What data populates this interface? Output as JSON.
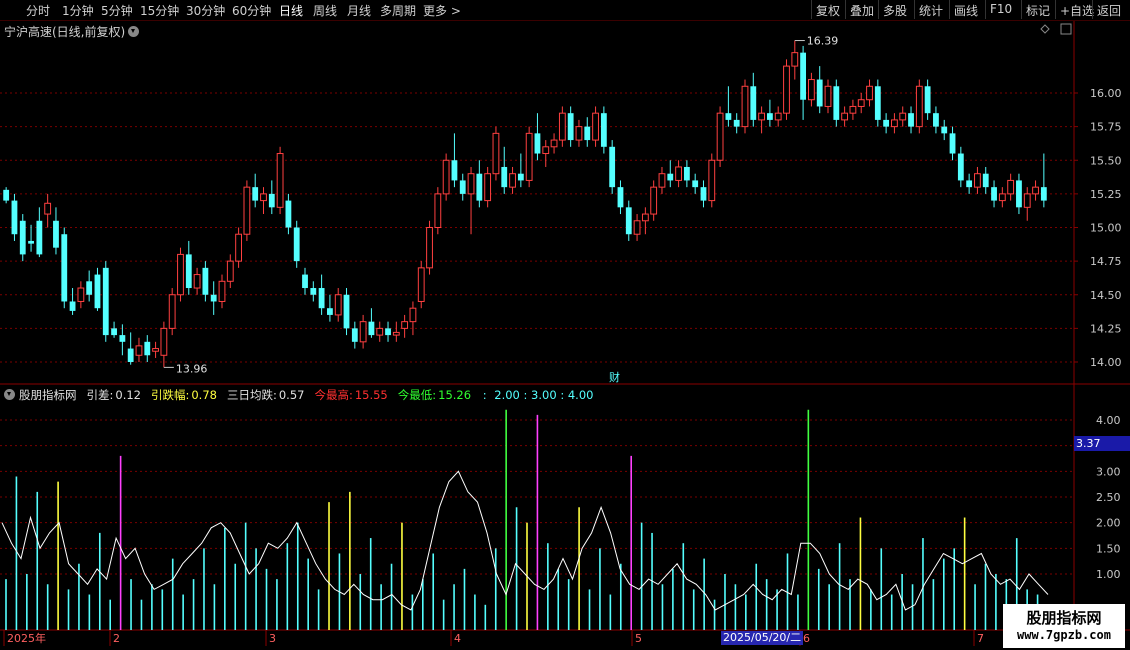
{
  "toolbar": {
    "periods": [
      "分时",
      "1分钟",
      "5分钟",
      "15分钟",
      "30分钟",
      "60分钟",
      "日线",
      "周线",
      "月线",
      "多周期",
      "更多 >"
    ],
    "active_period": "日线",
    "right_buttons": [
      "复权",
      "叠加",
      "多股",
      "统计",
      "画线",
      "F10",
      "标记",
      "+自选",
      "返回"
    ]
  },
  "stock": {
    "title": "宁沪高速(日线,前复权)",
    "max_label": "16.39",
    "min_label": "13.96",
    "finance_marker": "财"
  },
  "indicator": {
    "name": "股朋指标网",
    "fields": [
      {
        "label": "引差:",
        "value": "0.12",
        "label_color": "#e0e0e0",
        "value_color": "#e0e0e0"
      },
      {
        "label": "引跌幅:",
        "value": "0.78",
        "label_color": "#ffff40",
        "value_color": "#ffff40"
      },
      {
        "label": "三日均跌:",
        "value": "0.57",
        "label_color": "#e0e0e0",
        "value_color": "#e0e0e0"
      },
      {
        "label": "今最高:",
        "value": "15.55",
        "label_color": "#ff3030",
        "value_color": "#ff3030"
      },
      {
        "label": "今最低:",
        "value": "15.26",
        "label_color": "#30ff30",
        "value_color": "#30ff30"
      }
    ],
    "extra": "2.00 : 3.00 : 4.00",
    "extra_pre": " : ",
    "current_value": "3.37"
  },
  "price_axis": [
    "16.00",
    "15.75",
    "15.50",
    "15.25",
    "15.00",
    "14.75",
    "14.50",
    "14.25",
    "14.00"
  ],
  "indicator_axis": [
    "4.00",
    "3.50",
    "3.00",
    "2.50",
    "2.00",
    "1.50",
    "1.00"
  ],
  "time_axis": [
    "2025年",
    "2",
    "3",
    "4",
    "5",
    "6",
    "7"
  ],
  "cursor_date": "2025/05/20/二",
  "watermark": {
    "line1": "股朋指标网",
    "line2": "www.7gpzb.com"
  },
  "colors": {
    "up": "#ff4040",
    "down": "#54ffff",
    "grid": "#7a0000",
    "white_line": "#ffffff",
    "cyan_bar": "#54ffff",
    "yellow_bar": "#ffff40",
    "green_bar": "#40ff40",
    "magenta_bar": "#ff40ff"
  },
  "chart_data": {
    "type": "candlestick",
    "y_range": [
      13.9,
      16.5
    ],
    "candles": [
      [
        15.28,
        15.3,
        15.2,
        15.18
      ],
      [
        15.2,
        15.25,
        14.95,
        14.9
      ],
      [
        15.05,
        15.1,
        14.8,
        14.75
      ],
      [
        14.9,
        15.02,
        14.88,
        14.82
      ],
      [
        15.05,
        15.15,
        14.8,
        14.78
      ],
      [
        15.1,
        15.25,
        15.18,
        15.0
      ],
      [
        15.05,
        15.15,
        14.85,
        14.8
      ],
      [
        14.95,
        15.0,
        14.45,
        14.4
      ],
      [
        14.45,
        14.55,
        14.38,
        14.35
      ],
      [
        14.45,
        14.6,
        14.55,
        14.4
      ],
      [
        14.6,
        14.68,
        14.5,
        14.45
      ],
      [
        14.65,
        14.7,
        14.4,
        14.38
      ],
      [
        14.7,
        14.75,
        14.2,
        14.15
      ],
      [
        14.25,
        14.3,
        14.2,
        14.18
      ],
      [
        14.2,
        14.28,
        14.15,
        14.05
      ],
      [
        14.1,
        14.22,
        14.0,
        13.98
      ],
      [
        14.05,
        14.18,
        14.12,
        14.0
      ],
      [
        14.15,
        14.2,
        14.05,
        14.0
      ],
      [
        14.08,
        14.15,
        14.1,
        14.03
      ],
      [
        14.05,
        14.3,
        14.25,
        13.96
      ],
      [
        14.25,
        14.55,
        14.5,
        14.2
      ],
      [
        14.5,
        14.85,
        14.8,
        14.45
      ],
      [
        14.8,
        14.9,
        14.55,
        14.5
      ],
      [
        14.55,
        14.7,
        14.65,
        14.5
      ],
      [
        14.7,
        14.75,
        14.5,
        14.45
      ],
      [
        14.5,
        14.6,
        14.45,
        14.35
      ],
      [
        14.45,
        14.65,
        14.6,
        14.4
      ],
      [
        14.6,
        14.8,
        14.75,
        14.55
      ],
      [
        14.75,
        15.0,
        14.95,
        14.7
      ],
      [
        14.95,
        15.35,
        15.3,
        14.9
      ],
      [
        15.3,
        15.4,
        15.2,
        15.15
      ],
      [
        15.2,
        15.3,
        15.25,
        15.1
      ],
      [
        15.25,
        15.35,
        15.15,
        15.1
      ],
      [
        15.15,
        15.6,
        15.55,
        15.1
      ],
      [
        15.2,
        15.25,
        15.0,
        14.95
      ],
      [
        15.0,
        15.05,
        14.75,
        14.7
      ],
      [
        14.65,
        14.7,
        14.55,
        14.5
      ],
      [
        14.55,
        14.6,
        14.5,
        14.45
      ],
      [
        14.55,
        14.65,
        14.4,
        14.35
      ],
      [
        14.4,
        14.5,
        14.35,
        14.3
      ],
      [
        14.35,
        14.55,
        14.5,
        14.3
      ],
      [
        14.5,
        14.55,
        14.25,
        14.2
      ],
      [
        14.25,
        14.3,
        14.15,
        14.1
      ],
      [
        14.15,
        14.35,
        14.3,
        14.1
      ],
      [
        14.3,
        14.4,
        14.2,
        14.18
      ],
      [
        14.2,
        14.3,
        14.25,
        14.15
      ],
      [
        14.25,
        14.3,
        14.2,
        14.15
      ],
      [
        14.2,
        14.3,
        14.22,
        14.15
      ],
      [
        14.25,
        14.35,
        14.3,
        14.18
      ],
      [
        14.3,
        14.45,
        14.4,
        14.2
      ],
      [
        14.45,
        14.75,
        14.7,
        14.4
      ],
      [
        14.7,
        15.05,
        15.0,
        14.65
      ],
      [
        15.0,
        15.3,
        15.25,
        14.95
      ],
      [
        15.25,
        15.55,
        15.5,
        15.2
      ],
      [
        15.5,
        15.7,
        15.35,
        15.3
      ],
      [
        15.35,
        15.4,
        15.25,
        15.2
      ],
      [
        15.25,
        15.45,
        15.4,
        14.95
      ],
      [
        15.4,
        15.5,
        15.2,
        15.15
      ],
      [
        15.2,
        15.45,
        15.4,
        15.15
      ],
      [
        15.4,
        15.75,
        15.7,
        15.35
      ],
      [
        15.45,
        15.6,
        15.3,
        15.25
      ],
      [
        15.3,
        15.45,
        15.4,
        15.25
      ],
      [
        15.4,
        15.55,
        15.35,
        15.3
      ],
      [
        15.35,
        15.75,
        15.7,
        15.3
      ],
      [
        15.7,
        15.85,
        15.55,
        15.5
      ],
      [
        15.55,
        15.65,
        15.6,
        15.45
      ],
      [
        15.6,
        15.7,
        15.65,
        15.55
      ],
      [
        15.65,
        15.9,
        15.85,
        15.6
      ],
      [
        15.85,
        15.9,
        15.65,
        15.6
      ],
      [
        15.65,
        15.8,
        15.75,
        15.6
      ],
      [
        15.75,
        15.82,
        15.65,
        15.6
      ],
      [
        15.65,
        15.9,
        15.85,
        15.6
      ],
      [
        15.85,
        15.9,
        15.6,
        15.55
      ],
      [
        15.6,
        15.65,
        15.3,
        15.25
      ],
      [
        15.3,
        15.35,
        15.15,
        15.1
      ],
      [
        15.15,
        15.2,
        14.95,
        14.9
      ],
      [
        14.95,
        15.1,
        15.05,
        14.9
      ],
      [
        15.05,
        15.15,
        15.1,
        14.95
      ],
      [
        15.1,
        15.35,
        15.3,
        15.05
      ],
      [
        15.3,
        15.45,
        15.4,
        15.25
      ],
      [
        15.4,
        15.5,
        15.35,
        15.3
      ],
      [
        15.35,
        15.5,
        15.45,
        15.3
      ],
      [
        15.45,
        15.5,
        15.35,
        15.3
      ],
      [
        15.35,
        15.4,
        15.3,
        15.25
      ],
      [
        15.3,
        15.35,
        15.2,
        15.15
      ],
      [
        15.2,
        15.55,
        15.5,
        15.15
      ],
      [
        15.5,
        15.9,
        15.85,
        15.45
      ],
      [
        15.85,
        16.05,
        15.8,
        15.75
      ],
      [
        15.8,
        15.85,
        15.75,
        15.7
      ],
      [
        15.75,
        16.1,
        16.05,
        15.7
      ],
      [
        16.05,
        16.15,
        15.8,
        15.75
      ],
      [
        15.8,
        15.9,
        15.85,
        15.7
      ],
      [
        15.85,
        15.95,
        15.8,
        15.75
      ],
      [
        15.8,
        15.9,
        15.85,
        15.75
      ],
      [
        15.85,
        16.25,
        16.2,
        15.8
      ],
      [
        16.2,
        16.39,
        16.3,
        16.1
      ],
      [
        16.3,
        16.35,
        15.95,
        15.8
      ],
      [
        15.95,
        16.15,
        16.1,
        15.9
      ],
      [
        16.1,
        16.2,
        15.9,
        15.85
      ],
      [
        15.9,
        16.1,
        16.05,
        15.85
      ],
      [
        16.05,
        16.1,
        15.8,
        15.75
      ],
      [
        15.8,
        15.9,
        15.85,
        15.75
      ],
      [
        15.85,
        15.95,
        15.9,
        15.8
      ],
      [
        15.9,
        16.0,
        15.95,
        15.85
      ],
      [
        15.95,
        16.1,
        16.05,
        15.9
      ],
      [
        16.05,
        16.1,
        15.8,
        15.75
      ],
      [
        15.8,
        15.85,
        15.75,
        15.7
      ],
      [
        15.75,
        15.85,
        15.8,
        15.7
      ],
      [
        15.8,
        15.9,
        15.85,
        15.75
      ],
      [
        15.85,
        15.9,
        15.75,
        15.7
      ],
      [
        15.75,
        16.1,
        16.05,
        15.7
      ],
      [
        16.05,
        16.1,
        15.85,
        15.8
      ],
      [
        15.85,
        15.9,
        15.75,
        15.7
      ],
      [
        15.75,
        15.8,
        15.7,
        15.65
      ],
      [
        15.7,
        15.75,
        15.55,
        15.5
      ],
      [
        15.55,
        15.6,
        15.35,
        15.3
      ],
      [
        15.35,
        15.4,
        15.3,
        15.25
      ],
      [
        15.3,
        15.45,
        15.4,
        15.25
      ],
      [
        15.4,
        15.45,
        15.3,
        15.25
      ],
      [
        15.3,
        15.35,
        15.2,
        15.15
      ],
      [
        15.2,
        15.3,
        15.25,
        15.15
      ],
      [
        15.25,
        15.4,
        15.35,
        15.2
      ],
      [
        15.35,
        15.4,
        15.15,
        15.1
      ],
      [
        15.15,
        15.3,
        15.25,
        15.05
      ],
      [
        15.25,
        15.35,
        15.3,
        15.2
      ],
      [
        15.3,
        15.55,
        15.2,
        15.15
      ]
    ],
    "indicator_line": [
      2.0,
      1.6,
      1.3,
      2.1,
      1.5,
      1.8,
      2.0,
      1.2,
      1.0,
      0.8,
      1.1,
      0.9,
      1.7,
      1.3,
      1.5,
      1.0,
      0.7,
      0.8,
      0.9,
      1.2,
      1.4,
      1.6,
      1.9,
      2.0,
      1.8,
      1.4,
      1.0,
      1.2,
      1.6,
      1.5,
      1.7,
      2.0,
      1.6,
      1.2,
      0.9,
      0.7,
      0.6,
      0.8,
      0.6,
      0.5,
      0.5,
      0.6,
      0.4,
      0.3,
      0.7,
      1.5,
      2.3,
      2.8,
      3.0,
      2.6,
      2.4,
      1.8,
      1.0,
      0.6,
      1.2,
      1.0,
      0.8,
      0.7,
      0.9,
      1.3,
      0.9,
      1.5,
      1.8,
      2.3,
      1.8,
      1.1,
      0.8,
      0.7,
      0.9,
      0.8,
      1.0,
      1.2,
      0.9,
      0.8,
      0.6,
      0.3,
      0.4,
      0.5,
      0.6,
      0.8,
      0.6,
      0.5,
      0.7,
      0.6,
      1.6,
      1.6,
      1.4,
      1.0,
      0.8,
      0.7,
      0.9,
      0.8,
      0.5,
      0.6,
      0.8,
      0.3,
      0.4,
      0.8,
      1.1,
      1.4,
      1.3,
      1.2,
      1.3,
      1.4,
      1.0,
      0.8,
      0.9,
      0.7,
      1.0,
      0.8,
      0.6
    ],
    "indicator_bars": [
      [
        0.9,
        "c"
      ],
      [
        2.9,
        "c"
      ],
      [
        1.0,
        "c"
      ],
      [
        2.6,
        "c"
      ],
      [
        0.8,
        "c"
      ],
      [
        2.8,
        "y"
      ],
      [
        0.7,
        "c"
      ],
      [
        1.2,
        "c"
      ],
      [
        0.6,
        "c"
      ],
      [
        1.8,
        "c"
      ],
      [
        0.5,
        "c"
      ],
      [
        3.3,
        "m"
      ],
      [
        0.9,
        "c"
      ],
      [
        0.5,
        "c"
      ],
      [
        0.8,
        "c"
      ],
      [
        0.7,
        "c"
      ],
      [
        1.3,
        "c"
      ],
      [
        0.6,
        "c"
      ],
      [
        0.9,
        "c"
      ],
      [
        1.5,
        "c"
      ],
      [
        0.8,
        "c"
      ],
      [
        1.9,
        "c"
      ],
      [
        1.2,
        "c"
      ],
      [
        2.0,
        "c"
      ],
      [
        1.5,
        "c"
      ],
      [
        1.1,
        "c"
      ],
      [
        0.9,
        "c"
      ],
      [
        1.6,
        "c"
      ],
      [
        2.0,
        "c"
      ],
      [
        1.3,
        "c"
      ],
      [
        0.7,
        "c"
      ],
      [
        2.4,
        "y"
      ],
      [
        1.4,
        "c"
      ],
      [
        2.6,
        "y"
      ],
      [
        1.0,
        "c"
      ],
      [
        1.7,
        "c"
      ],
      [
        0.8,
        "c"
      ],
      [
        1.2,
        "c"
      ],
      [
        2.0,
        "y"
      ],
      [
        0.6,
        "c"
      ],
      [
        0.9,
        "c"
      ],
      [
        1.4,
        "c"
      ],
      [
        0.5,
        "c"
      ],
      [
        0.8,
        "c"
      ],
      [
        1.1,
        "c"
      ],
      [
        0.6,
        "c"
      ],
      [
        0.4,
        "c"
      ],
      [
        1.5,
        "c"
      ],
      [
        4.2,
        "g"
      ],
      [
        2.3,
        "c"
      ],
      [
        2.0,
        "y"
      ],
      [
        4.1,
        "m"
      ],
      [
        1.6,
        "c"
      ],
      [
        1.1,
        "c"
      ],
      [
        0.9,
        "c"
      ],
      [
        2.3,
        "y"
      ],
      [
        0.7,
        "c"
      ],
      [
        1.5,
        "c"
      ],
      [
        0.6,
        "c"
      ],
      [
        1.2,
        "c"
      ],
      [
        3.3,
        "m"
      ],
      [
        2.0,
        "c"
      ],
      [
        1.8,
        "c"
      ],
      [
        0.8,
        "c"
      ],
      [
        1.1,
        "c"
      ],
      [
        1.6,
        "c"
      ],
      [
        0.7,
        "c"
      ],
      [
        1.3,
        "c"
      ],
      [
        0.5,
        "c"
      ],
      [
        1.0,
        "c"
      ],
      [
        0.8,
        "c"
      ],
      [
        0.6,
        "c"
      ],
      [
        1.2,
        "c"
      ],
      [
        0.9,
        "c"
      ],
      [
        0.7,
        "c"
      ],
      [
        1.4,
        "c"
      ],
      [
        0.6,
        "c"
      ],
      [
        4.2,
        "g"
      ],
      [
        1.1,
        "c"
      ],
      [
        0.8,
        "c"
      ],
      [
        1.6,
        "c"
      ],
      [
        0.9,
        "c"
      ],
      [
        2.1,
        "y"
      ],
      [
        0.7,
        "c"
      ],
      [
        1.5,
        "c"
      ],
      [
        0.6,
        "c"
      ],
      [
        1.0,
        "c"
      ],
      [
        0.8,
        "c"
      ],
      [
        1.7,
        "c"
      ],
      [
        0.9,
        "c"
      ],
      [
        1.3,
        "c"
      ],
      [
        1.5,
        "c"
      ],
      [
        2.1,
        "y"
      ],
      [
        0.8,
        "c"
      ],
      [
        1.2,
        "c"
      ],
      [
        1.0,
        "c"
      ],
      [
        0.9,
        "c"
      ],
      [
        1.7,
        "c"
      ],
      [
        0.7,
        "c"
      ],
      [
        0.6,
        "c"
      ]
    ]
  }
}
